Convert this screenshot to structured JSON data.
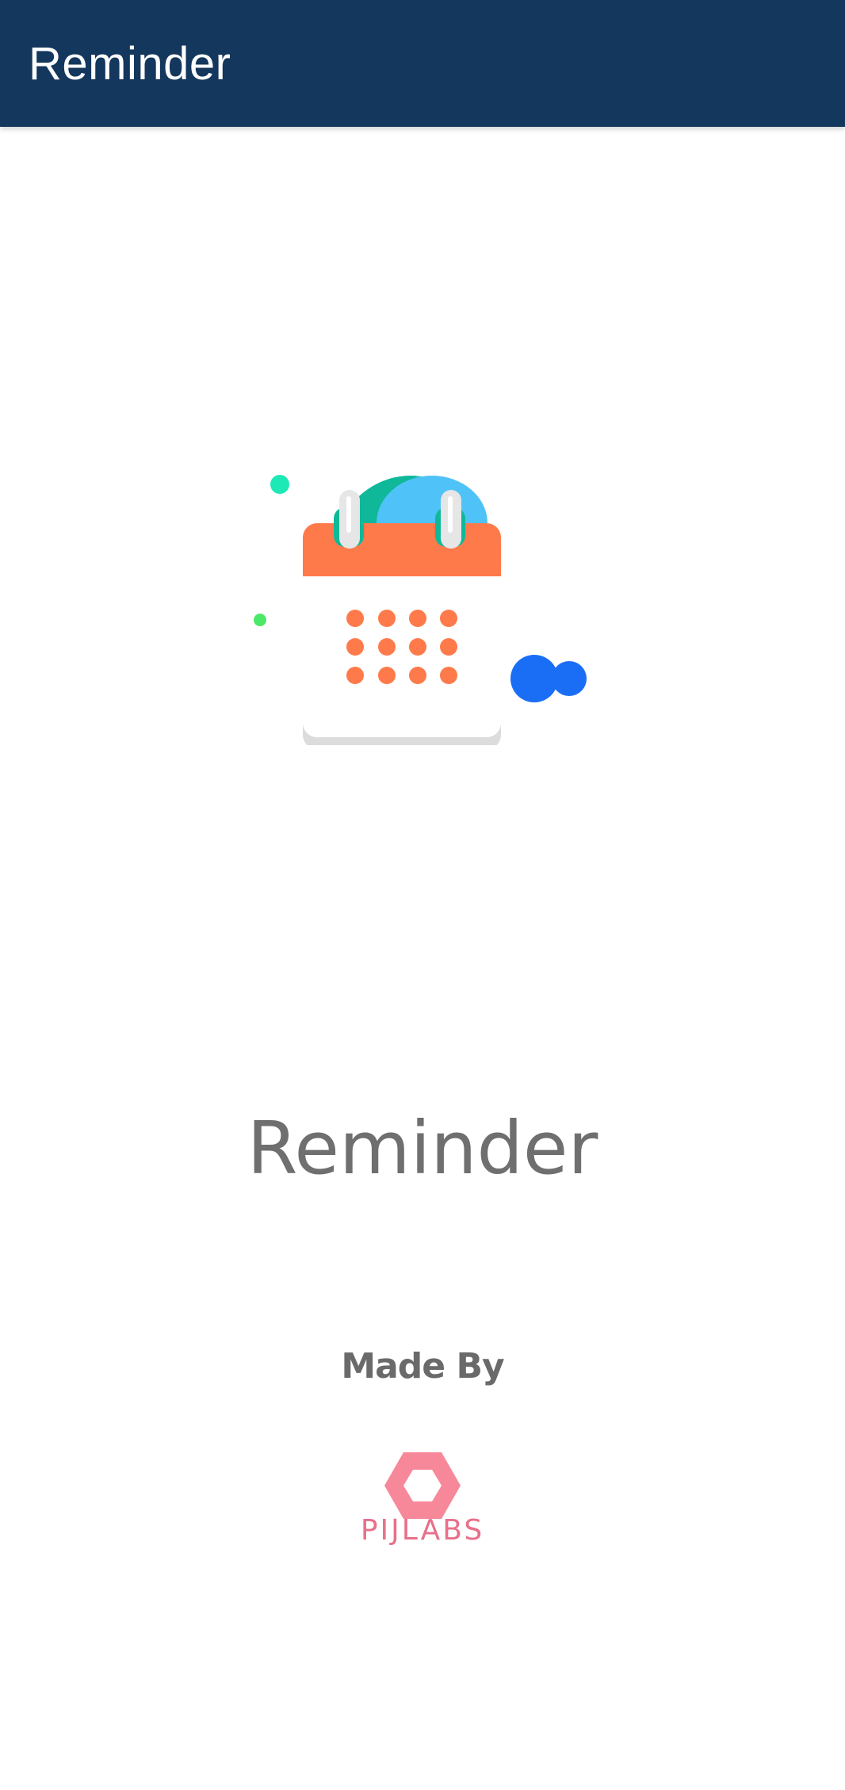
{
  "app_bar": {
    "title": "Reminder",
    "background_color": "#14375d"
  },
  "splash": {
    "illustration": "calendar-icon",
    "app_name": "Reminder",
    "made_by_label": "Made By",
    "brand": {
      "logo_icon": "hexagon-logo-icon",
      "name": "PIJLABS",
      "color": "#e8708a"
    }
  },
  "colors": {
    "calendar_header": "#ff7a4a",
    "calendar_dots": "#ff7a4a",
    "accent_teal": "#10b89a",
    "accent_blue": "#1a6ef5"
  }
}
